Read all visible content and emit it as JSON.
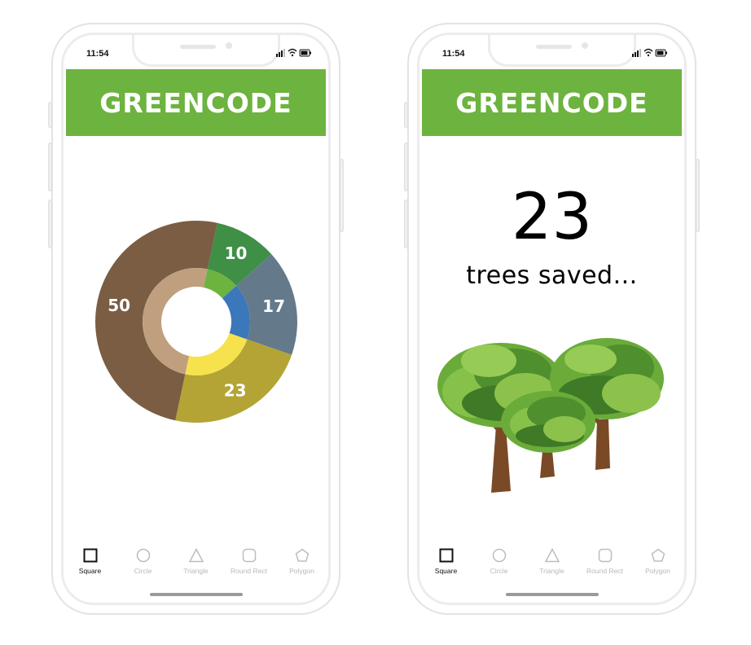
{
  "phones": [
    {
      "status_time": "11:54",
      "header_title": "GREENCODE"
    },
    {
      "status_time": "11:54",
      "header_title": "GREENCODE",
      "trees_count": "23",
      "trees_caption": "trees saved..."
    }
  ],
  "tabbar": [
    {
      "label": "Square",
      "icon": "square-icon",
      "active": true
    },
    {
      "label": "Circle",
      "icon": "circle-icon",
      "active": false
    },
    {
      "label": "Triangle",
      "icon": "triangle-icon",
      "active": false
    },
    {
      "label": "Round Rect",
      "icon": "round-rect-icon",
      "active": false
    },
    {
      "label": "Polygon",
      "icon": "polygon-icon",
      "active": false
    }
  ],
  "chart_data": {
    "type": "pie",
    "categories": [
      "10",
      "17",
      "23",
      "50"
    ],
    "values": [
      10,
      17,
      23,
      50
    ],
    "outer_colors": [
      "#3f8f47",
      "#647a8b",
      "#b3a435",
      "#7a5d43"
    ],
    "inner_colors": [
      "#6db33f",
      "#3a78bb",
      "#f5e24d",
      "#bf9f7e"
    ],
    "label_color": "#ffffff",
    "title": "",
    "xlabel": "",
    "ylabel": ""
  },
  "colors": {
    "brand_green": "#6db33f",
    "tab_active": "#111111",
    "tab_inactive": "#b8b8b8"
  }
}
